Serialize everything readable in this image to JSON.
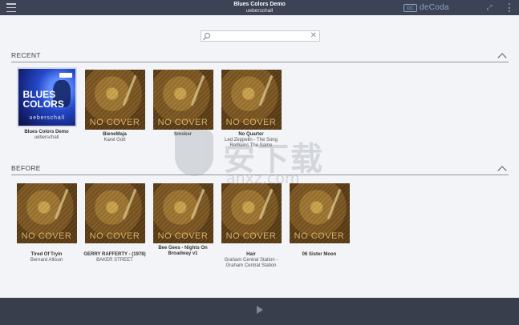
{
  "titlebar": {
    "title": "Blues Colors Demo",
    "subtitle": "ueberschall",
    "brand_logo": "DC",
    "brand_name": "deCoda"
  },
  "search": {
    "value": "",
    "clear_symbol": "✕"
  },
  "sections": {
    "recent": {
      "title": "RECENT",
      "items": [
        {
          "title": "Blues Colors Demo",
          "subtitle": "ueberschall",
          "cover": "blues",
          "cover_text": "BLUES COLORS",
          "cover_brand": "ueberschall"
        },
        {
          "title": "BieneMaja",
          "subtitle": "Karel Gott",
          "cover": "nocover",
          "cover_label": "NO COVER"
        },
        {
          "title": "Smoker",
          "subtitle": "",
          "cover": "nocover",
          "cover_label": "NO COVER"
        },
        {
          "title": "No Quarter",
          "subtitle": "Led Zeppelin - The Song Remains The Same",
          "cover": "nocover",
          "cover_label": "NO COVER"
        }
      ]
    },
    "before": {
      "title": "BEFORE",
      "items": [
        {
          "title": "Tired Of Tryin",
          "subtitle": "Bernard Allison",
          "cover": "nocover",
          "cover_label": "NO COVER"
        },
        {
          "title": "GERRY RAFFERTY - (1978)",
          "subtitle": "BAKER STREET",
          "cover": "nocover",
          "cover_label": "NO COVER"
        },
        {
          "title": "Bee Gees - Nights On Broadway v1",
          "subtitle": "",
          "cover": "nocover",
          "cover_label": "NO COVER"
        },
        {
          "title": "Hair",
          "subtitle": "Graham Central Station - Graham Central Station",
          "cover": "nocover",
          "cover_label": "NO COVER"
        },
        {
          "title": "06 Sister Moon",
          "subtitle": "",
          "cover": "nocover",
          "cover_label": "NO COVER"
        }
      ]
    }
  },
  "watermark": {
    "text": "安下载",
    "domain": "anxz.com"
  },
  "icons": {
    "menu": "hamburger-icon",
    "search": "search-icon",
    "collapse": "chevron-up-icon",
    "play": "play-icon",
    "expand": "expand-icon",
    "more": "more-vertical-icon"
  }
}
